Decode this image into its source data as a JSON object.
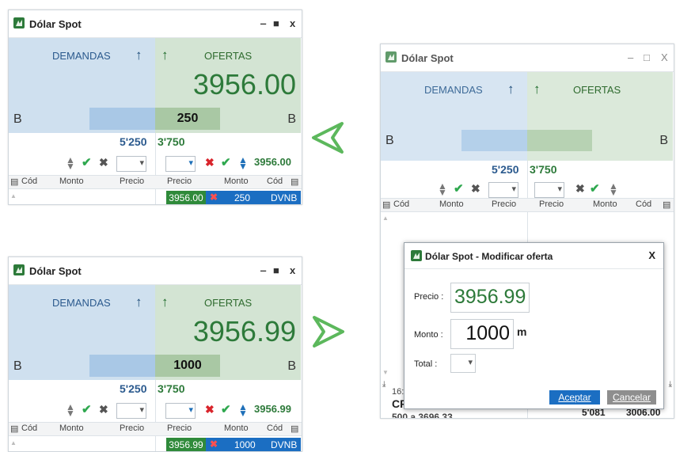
{
  "windows": [
    {
      "title": "Dólar Spot",
      "controls": {
        "minimize": "‒",
        "maximize": "■",
        "close": "x"
      },
      "demandas_label": "DEMANDAS",
      "ofertas_label": "OFERTAS",
      "price": "3956.00",
      "b_left": "B",
      "b_right": "B",
      "qty": "250",
      "total_demand": "5'250",
      "total_offer": "3'750",
      "offer_price_field": "3956.00",
      "headers": {
        "cod": "Cód",
        "monto": "Monto",
        "precio": "Precio"
      },
      "row": {
        "precio": "3956.00",
        "monto": "250",
        "cod": "DVNB"
      }
    },
    {
      "title": "Dólar Spot",
      "controls": {
        "minimize": "‒",
        "maximize": "■",
        "close": "x"
      },
      "demandas_label": "DEMANDAS",
      "ofertas_label": "OFERTAS",
      "price": "3956.99",
      "b_left": "B",
      "b_right": "B",
      "qty": "1000",
      "total_demand": "5'250",
      "total_offer": "3'750",
      "offer_price_field": "3956.99",
      "headers": {
        "cod": "Cód",
        "monto": "Monto",
        "precio": "Precio"
      },
      "row": {
        "precio": "3956.99",
        "monto": "1000",
        "cod": "DVNB"
      }
    }
  ],
  "window_right": {
    "title": "Dólar Spot",
    "controls": {
      "minimize": "‒",
      "maximize": "□",
      "close": "X"
    },
    "demandas_label": "DEMANDAS",
    "ofertas_label": "OFERTAS",
    "b_left": "B",
    "b_right": "B",
    "total_demand": "5'250",
    "total_offer": "3'750",
    "headers": {
      "cod": "Cód",
      "monto": "Monto",
      "precio": "Precio"
    },
    "bottom": {
      "time": "16:",
      "code": "CF",
      "line": "500 a 3696.33",
      "col1": "5'081",
      "col2": "3006.00"
    }
  },
  "dialog": {
    "title": "Dólar Spot - Modificar oferta",
    "close": "X",
    "precio_label": "Precio :",
    "precio_value": "3956.99",
    "monto_label": "Monto :",
    "monto_value": "1000",
    "monto_unit": "m",
    "total_label": "Total :",
    "accept": "Aceptar",
    "cancel": "Cancelar"
  },
  "colors": {
    "accent_green": "#2d7a3a",
    "accent_blue": "#1b6ec2",
    "demand_bg": "#cfe0ef",
    "offer_bg": "#d3e4d3"
  }
}
